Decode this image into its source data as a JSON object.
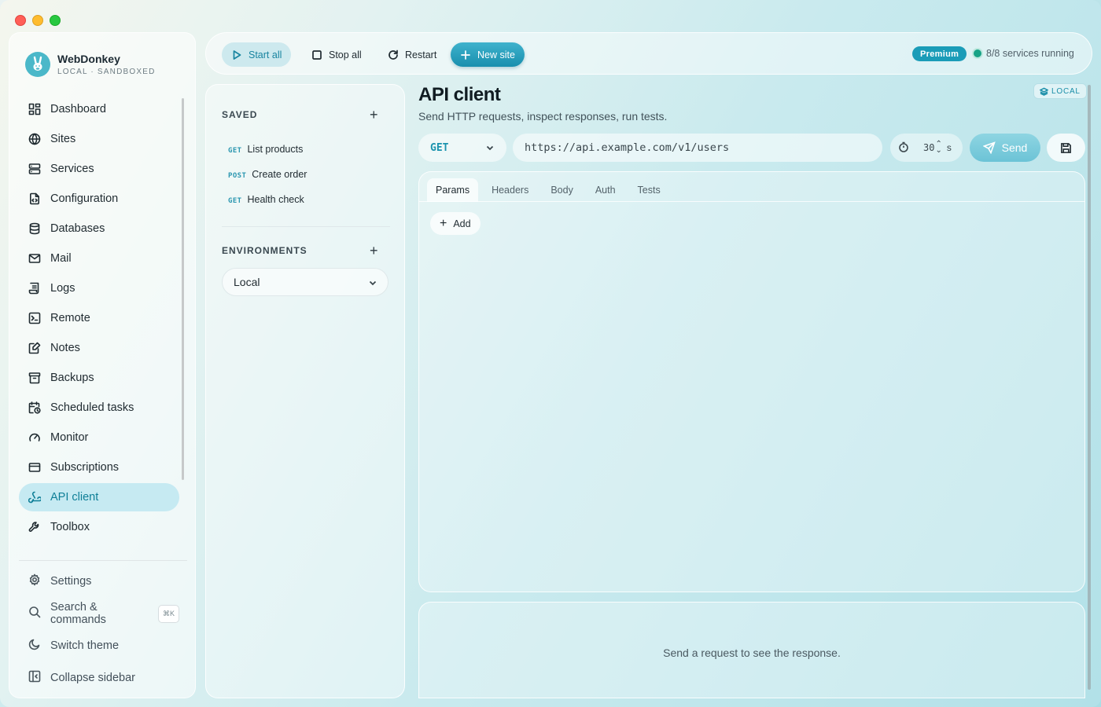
{
  "brand": {
    "name": "WebDonkey",
    "subtitle": "LOCAL · SANDBOXED"
  },
  "sidebar": {
    "items": [
      {
        "label": "Dashboard",
        "icon": "dashboard-icon"
      },
      {
        "label": "Sites",
        "icon": "globe-icon"
      },
      {
        "label": "Services",
        "icon": "server-icon"
      },
      {
        "label": "Configuration",
        "icon": "config-file-icon"
      },
      {
        "label": "Databases",
        "icon": "database-icon"
      },
      {
        "label": "Mail",
        "icon": "mail-icon"
      },
      {
        "label": "Logs",
        "icon": "logs-icon"
      },
      {
        "label": "Remote",
        "icon": "terminal-icon"
      },
      {
        "label": "Notes",
        "icon": "notes-icon"
      },
      {
        "label": "Backups",
        "icon": "archive-icon"
      },
      {
        "label": "Scheduled tasks",
        "icon": "calendar-clock-icon"
      },
      {
        "label": "Monitor",
        "icon": "gauge-icon"
      },
      {
        "label": "Subscriptions",
        "icon": "credit-card-icon"
      },
      {
        "label": "API client",
        "icon": "webhook-icon",
        "active": true
      },
      {
        "label": "Toolbox",
        "icon": "wrench-icon"
      }
    ],
    "bottom": {
      "settings": "Settings",
      "search": "Search & commands",
      "search_shortcut": "⌘K",
      "theme": "Switch theme",
      "collapse": "Collapse sidebar"
    }
  },
  "toolbar": {
    "start_all": "Start all",
    "stop_all": "Stop all",
    "restart": "Restart",
    "new_site": "New site",
    "premium": "Premium",
    "status": "8/8 services running"
  },
  "saved": {
    "heading": "SAVED",
    "requests": [
      {
        "method": "GET",
        "name": "List products"
      },
      {
        "method": "POST",
        "name": "Create order"
      },
      {
        "method": "GET",
        "name": "Health check"
      }
    ]
  },
  "environments": {
    "heading": "ENVIRONMENTS",
    "selected": "Local"
  },
  "main": {
    "title": "API client",
    "subtitle": "Send HTTP requests, inspect responses, run tests.",
    "badge": "LOCAL",
    "method": "GET",
    "url": "https://api.example.com/v1/users",
    "timeout_value": "30",
    "timeout_unit": "s",
    "send": "Send",
    "tabs": [
      "Params",
      "Headers",
      "Body",
      "Auth",
      "Tests"
    ],
    "active_tab": "Params",
    "add": "Add",
    "response_empty": "Send a request to see the response."
  },
  "colors": {
    "accent": "#1a9cb8",
    "active_nav_bg": "#c6eaf2",
    "status_green": "#17a386"
  }
}
